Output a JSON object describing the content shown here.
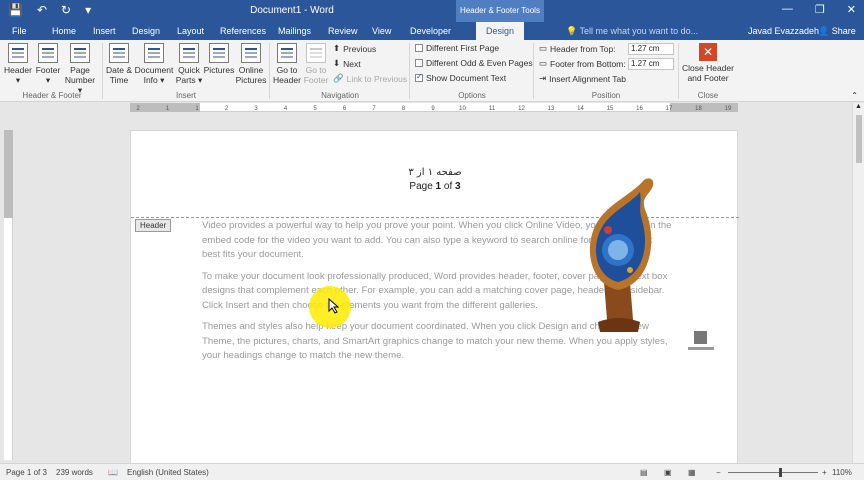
{
  "window": {
    "title": "Document1 - Word",
    "contextual_tab_group": "Header & Footer Tools",
    "minimize": "—",
    "restore": "❐",
    "close": "✕"
  },
  "qat": {
    "save": "💾",
    "undo": "↶",
    "redo": "↻",
    "customize": "▾"
  },
  "tabs": [
    "File",
    "Home",
    "Insert",
    "Design",
    "Layout",
    "References",
    "Mailings",
    "Review",
    "View",
    "Developer"
  ],
  "active_tab": "Design",
  "tell_me": "Tell me what you want to do...",
  "user": "Javad Evazzadeh",
  "share": "Share",
  "ribbon": {
    "header": "Header",
    "footer": "Footer",
    "page_number_line1": "Page",
    "page_number_line2": "Number ▾",
    "date_time_line1": "Date &",
    "date_time_line2": "Time",
    "doc_info_line1": "Document",
    "doc_info_line2": "Info ▾",
    "quick_parts_line1": "Quick",
    "quick_parts_line2": "Parts ▾",
    "pictures": "Pictures",
    "online_pictures_line1": "Online",
    "online_pictures_line2": "Pictures",
    "goto_header_line1": "Go to",
    "goto_header_line2": "Header",
    "goto_footer_line1": "Go to",
    "goto_footer_line2": "Footer",
    "previous": "Previous",
    "next": "Next",
    "link_to_previous": "Link to Previous",
    "diff_first_page": "Different First Page",
    "diff_odd_even": "Different Odd & Even Pages",
    "show_doc_text": "Show Document Text",
    "header_from_top": "Header from Top:",
    "header_from_top_value": "1.27 cm",
    "footer_from_bottom": "Footer from Bottom:",
    "footer_from_bottom_value": "1.27 cm",
    "insert_alignment_tab": "Insert Alignment Tab",
    "close_hf_line1": "Close Header",
    "close_hf_line2": "and Footer",
    "groups": {
      "header_footer": "Header & Footer",
      "insert": "Insert",
      "navigation": "Navigation",
      "options": "Options",
      "position": "Position",
      "close": "Close"
    }
  },
  "ruler_numbers": [
    "2",
    "1",
    "1",
    "2",
    "3",
    "4",
    "5",
    "6",
    "7",
    "8",
    "9",
    "10",
    "11",
    "12",
    "13",
    "14",
    "15",
    "16",
    "17",
    "18",
    "19"
  ],
  "document": {
    "page_number_arabic": "صفحه ۱ از ۳",
    "page_number_prefix": "Page ",
    "page_current": "1",
    "page_of": " of ",
    "page_total": "3",
    "header_tag": "Header",
    "paragraphs": [
      "Video provides a powerful way to help you prove your point. When you click Online Video, you can paste in the embed code for the video you want to add. You can also type a keyword to search online for the video that best fits your document.",
      "To make your document look professionally produced, Word provides header, footer, cover page, and text box designs that complement each other. For example, you can add a matching cover page, header, and sidebar. Click Insert and then choose the elements you want from the different galleries.",
      "Themes and styles also help keep your document coordinated. When you click Design and choose a new Theme, the pictures, charts, and SmartArt graphics change to match your new theme. When you apply styles, your headings change to match the new theme."
    ]
  },
  "status": {
    "page": "Page 1 of 3",
    "words": "239 words",
    "language": "English (United States)",
    "zoom_minus": "−",
    "zoom_plus": "+",
    "zoom": "110%"
  },
  "colors": {
    "accent": "#2b579a",
    "close_red": "#d24726",
    "highlight": "#ffeb00"
  }
}
